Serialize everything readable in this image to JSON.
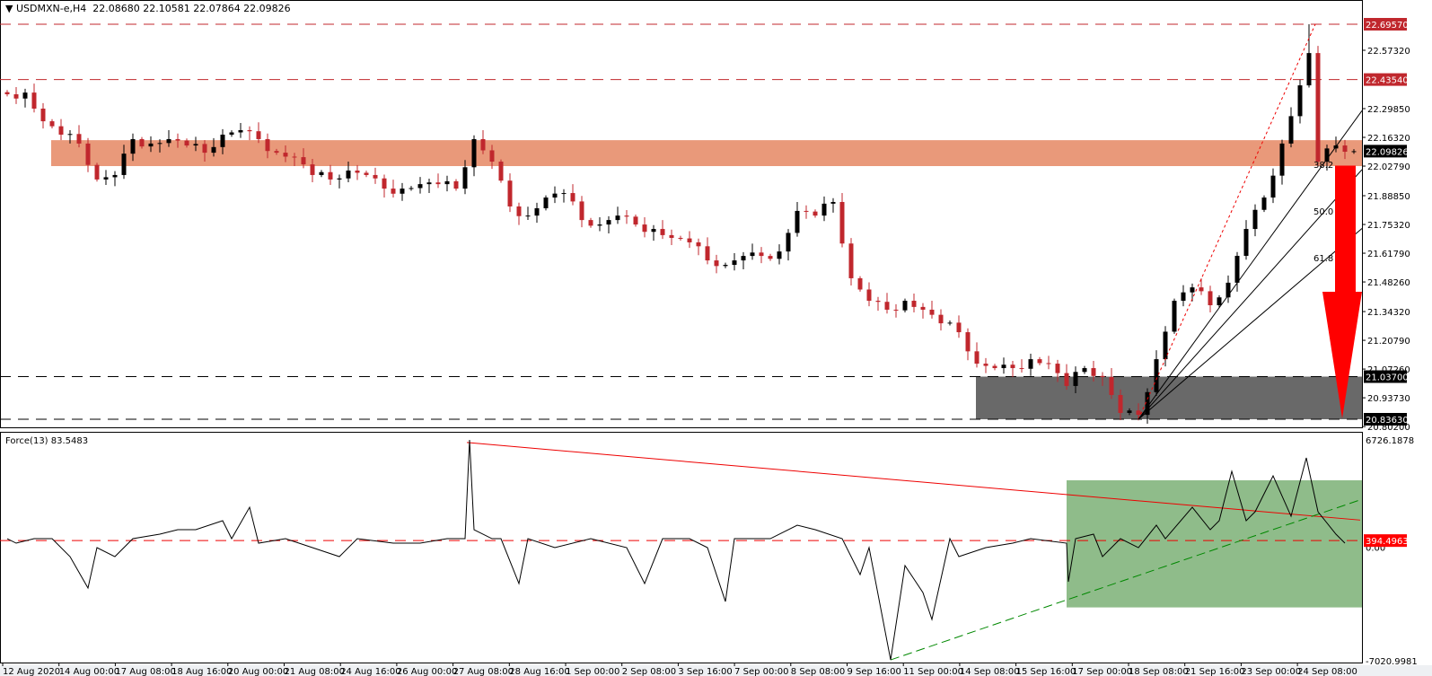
{
  "header": {
    "symbol": "USDMXN-e,H4",
    "ohlc": "22.08680 22.10581 22.07864 22.09826"
  },
  "indicator": {
    "label": "Force(13) 83.5483"
  },
  "colors": {
    "bull": "#000000",
    "bear": "#c0272d",
    "resistance_zone": "#e9997a",
    "support_zone": "#696969",
    "force_zone": "#8fbc8a",
    "arrow": "#ff0000",
    "level_red": "#c0272d"
  },
  "chart_data": [
    {
      "type": "candlestick",
      "title": "USDMXN-e,H4",
      "ylim": [
        20.802,
        22.72
      ],
      "price_ticks": [
        "22.57320",
        "22.29850",
        "22.16320",
        "22.02790",
        "21.88850",
        "21.75320",
        "21.61790",
        "21.48260",
        "21.34320",
        "21.20790",
        "21.07260",
        "20.93730",
        "20.80200"
      ],
      "levels": [
        {
          "value": "22.69570",
          "style": "red-dashed"
        },
        {
          "value": "22.43540",
          "style": "red-dashed"
        },
        {
          "value": "21.03700",
          "style": "black-dashed"
        },
        {
          "value": "20.83630",
          "style": "black-dashed"
        }
      ],
      "current_price": "22.09826",
      "resistance_zone": [
        22.028,
        22.15
      ],
      "support_zone": [
        20.8363,
        21.037
      ],
      "closes_every_2_bars": [
        22.366,
        22.374,
        22.239,
        22.176,
        22.134,
        21.965,
        21.986,
        22.155,
        22.134,
        22.155,
        22.125,
        22.091,
        22.176,
        22.197,
        22.155,
        22.091,
        22.07,
        21.986,
        21.965,
        22.007,
        21.986,
        21.922,
        21.922,
        21.943,
        21.943,
        21.922,
        22.155,
        22.049,
        21.838,
        21.795,
        21.88,
        21.901,
        21.774,
        21.753,
        21.795,
        21.753,
        21.732,
        21.69,
        21.669,
        21.584,
        21.563,
        21.605,
        21.605,
        21.626,
        21.817,
        21.795,
        21.859,
        21.5,
        21.394,
        21.352,
        21.394,
        21.352,
        21.288,
        21.246,
        21.098,
        21.077,
        21.077,
        21.119,
        21.098,
        20.993,
        21.077,
        21.035,
        20.866,
        20.857,
        21.119,
        21.394,
        21.457,
        21.373,
        21.479,
        21.732,
        21.88,
        22.134,
        22.408,
        22.049,
        22.125,
        22.098
      ],
      "spike": {
        "bar": 145,
        "close": 22.56,
        "high": 22.6957
      },
      "fibonacci_fan": {
        "from": {
          "bar": 126,
          "price": 20.8363
        },
        "to": {
          "bar": 145.7,
          "price": 22.6957
        },
        "levels": [
          "38.2",
          "50.0",
          "61.8"
        ]
      },
      "forecast_arrow": {
        "direction": "down",
        "from_price": 22.03,
        "to_price": 20.84
      },
      "time_labels": [
        "12 Aug 2020",
        "14 Aug 00:00",
        "17 Aug 08:00",
        "18 Aug 16:00",
        "20 Aug 00:00",
        "21 Aug 08:00",
        "24 Aug 16:00",
        "26 Aug 00:00",
        "27 Aug 08:00",
        "28 Aug 16:00",
        "1 Sep 00:00",
        "2 Sep 08:00",
        "3 Sep 16:00",
        "7 Sep 00:00",
        "8 Sep 08:00",
        "9 Sep 16:00",
        "11 Sep 00:00",
        "14 Sep 08:00",
        "15 Sep 16:00",
        "17 Sep 00:00",
        "18 Sep 08:00",
        "21 Sep 16:00",
        "23 Sep 00:00",
        "24 Sep 08:00"
      ]
    },
    {
      "type": "line",
      "title": "Force(13) 83.5483",
      "ylim": [
        -7020.9981,
        6726.1878
      ],
      "ticks": [
        "6726.1878",
        "0.00",
        "-7020.9981"
      ],
      "level": "394.4963",
      "points": [
        [
          0,
          511
        ],
        [
          1,
          236
        ],
        [
          3,
          511
        ],
        [
          5,
          511
        ],
        [
          7,
          -589
        ],
        [
          9,
          -2514
        ],
        [
          10,
          -39
        ],
        [
          12,
          -589
        ],
        [
          14,
          511
        ],
        [
          17,
          786
        ],
        [
          19,
          1061
        ],
        [
          21,
          1061
        ],
        [
          24,
          1611
        ],
        [
          25,
          511
        ],
        [
          27,
          2436
        ],
        [
          28,
          236
        ],
        [
          31,
          511
        ],
        [
          34,
          -39
        ],
        [
          37,
          -589
        ],
        [
          39,
          511
        ],
        [
          43,
          236
        ],
        [
          46,
          236
        ],
        [
          49,
          511
        ],
        [
          51,
          511
        ],
        [
          51.5,
          6561
        ],
        [
          52,
          1061
        ],
        [
          54,
          511
        ],
        [
          55,
          511
        ],
        [
          57,
          -2239
        ],
        [
          58,
          511
        ],
        [
          61,
          -39
        ],
        [
          65,
          511
        ],
        [
          69,
          -39
        ],
        [
          71,
          -2239
        ],
        [
          73,
          511
        ],
        [
          76,
          511
        ],
        [
          78,
          -39
        ],
        [
          80,
          -3339
        ],
        [
          81,
          511
        ],
        [
          85,
          511
        ],
        [
          88,
          1336
        ],
        [
          90,
          1061
        ],
        [
          93,
          511
        ],
        [
          95,
          -1689
        ],
        [
          96,
          -39
        ],
        [
          98.4,
          -6914
        ],
        [
          100,
          -1139
        ],
        [
          102,
          -2789
        ],
        [
          103,
          -4439
        ],
        [
          105,
          511
        ],
        [
          106,
          -589
        ],
        [
          109,
          -39
        ],
        [
          112,
          236
        ],
        [
          114,
          511
        ],
        [
          118,
          236
        ],
        [
          118.2,
          -2129
        ],
        [
          119,
          511
        ],
        [
          121,
          786
        ],
        [
          122,
          -589
        ],
        [
          124,
          511
        ],
        [
          126,
          -39
        ],
        [
          128,
          1336
        ],
        [
          129,
          511
        ],
        [
          132,
          2436
        ],
        [
          134,
          1061
        ],
        [
          135,
          1611
        ],
        [
          136.4,
          4636
        ],
        [
          138,
          1611
        ],
        [
          139,
          2161
        ],
        [
          141,
          4361
        ],
        [
          143,
          1886
        ],
        [
          144.7,
          5461
        ],
        [
          146,
          2161
        ],
        [
          148,
          786
        ],
        [
          149,
          236
        ]
      ],
      "red_trendline": [
        [
          51.2,
          6400
        ],
        [
          150.7,
          1650
        ]
      ],
      "green_trendline": [
        [
          98.4,
          -6914
        ],
        [
          150.7,
          2886
        ]
      ],
      "green_zone": {
        "bars": [
          118,
          151
        ],
        "values": [
          4086,
          -3700
        ]
      }
    }
  ]
}
